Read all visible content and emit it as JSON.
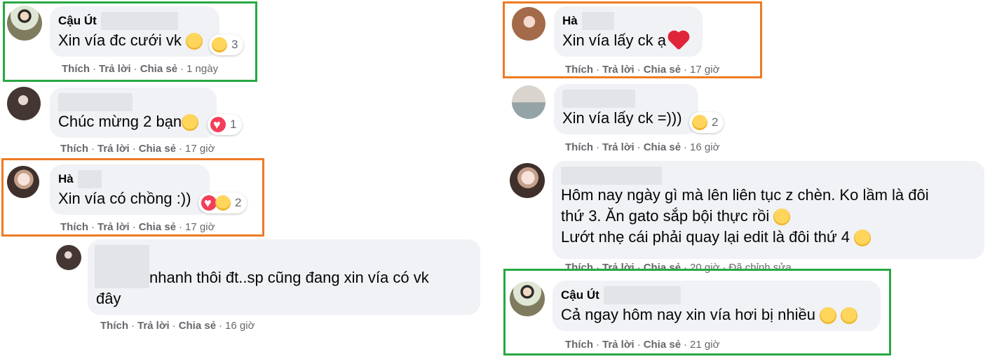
{
  "actions": {
    "like": "Thích",
    "reply": "Trả lời",
    "share": "Chia sẻ",
    "sep": "·"
  },
  "highlight_colors": {
    "green": "#27a844",
    "orange": "#ee7a22"
  },
  "comments": [
    {
      "author": "Cậu Út",
      "text": "Xin vía đc cưới vk",
      "emoji": "smile-emoji",
      "reaction_icons": [
        "haha-reaction-icon"
      ],
      "reaction_count": "3",
      "time": "1 ngày"
    },
    {
      "author": "",
      "text": "Chúc mừng 2 bạn",
      "emoji": "kiss-emoji",
      "reaction_icons": [
        "love-reaction-icon"
      ],
      "reaction_count": "1",
      "time": "17 giờ"
    },
    {
      "author": "Hà",
      "text": "Xin vía có chồng :))",
      "reaction_icons": [
        "love-reaction-icon",
        "care-reaction-icon"
      ],
      "reaction_count": "2",
      "time": "17 giờ"
    },
    {
      "author": "",
      "text_line1": "nhanh thôi đt..sp cũng đang xin vía có vk",
      "text_line2": "đây",
      "time": "16 giờ"
    },
    {
      "author": "Hà",
      "text": "Xin vía lấy ck ạ",
      "emoji": "red-heart-emoji",
      "time": "17 giờ"
    },
    {
      "author": "",
      "text": "Xin vía lấy ck =)))",
      "reaction_icons": [
        "haha-reaction-icon"
      ],
      "reaction_count": "2",
      "time": "16 giờ"
    },
    {
      "author": "",
      "line1": "Hôm nay ngày gì mà lên liên tục z chèn. Ko lầm là đôi",
      "line2": "thứ 3. Ăn gato sắp bội thực rồi",
      "line3": "Lướt nhẹ cái phải quay lại edit là đôi thứ 4",
      "emoji_line2": "laughing-tears-emoji",
      "emoji_line3": "upside-down-face-emoji",
      "time": "20 giờ",
      "edited": "Đã chỉnh sửa"
    },
    {
      "author": "Cậu Út",
      "text": "Cả ngay hôm nay xin vía hơi bị nhiều",
      "emoji": "relieved-face-emoji",
      "time": "21 giờ"
    }
  ]
}
